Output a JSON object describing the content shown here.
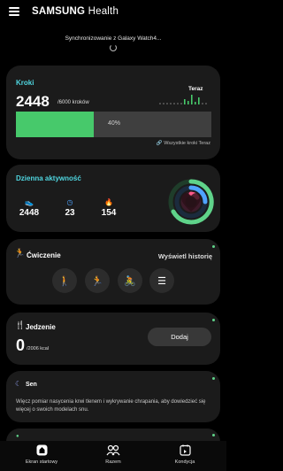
{
  "header": {
    "brand_bold": "SAMSUNG",
    "brand_light": "Health",
    "sync_text": "Synchronizowanie z Galaxy Watch4..."
  },
  "steps": {
    "title": "Kroki",
    "value": "2448",
    "goal": "/6000 kroków",
    "now_label": "Teraz",
    "progress_label": "40%",
    "progress_fraction": 0.4,
    "all_steps_link": "Wszystkie kroki Teraz",
    "accent": "#47c96b"
  },
  "activity": {
    "title": "Dzienna aktywność",
    "items": [
      {
        "icon": "steps-icon",
        "value": "2448",
        "color": "#5fd38a"
      },
      {
        "icon": "active-time-icon",
        "value": "23",
        "color": "#4fa3ff"
      },
      {
        "icon": "calories-icon",
        "value": "154",
        "color": "#ff5a8a"
      }
    ],
    "ring_colors": [
      "#5fd38a",
      "#4fa3ff",
      "#ff5a8a"
    ]
  },
  "exercise": {
    "title": "Ćwiczenie",
    "show_history": "Wyświetl historię",
    "buttons": [
      {
        "icon": "walking-icon",
        "glyph": "🚶"
      },
      {
        "icon": "running-icon",
        "glyph": "🏃"
      },
      {
        "icon": "cycling-icon",
        "glyph": "🚴"
      },
      {
        "icon": "list-icon",
        "glyph": "☰"
      }
    ]
  },
  "food": {
    "title": "Jedzenie",
    "value": "0",
    "unit": "/2006 kcal",
    "add_label": "Dodaj"
  },
  "sleep": {
    "title": "Sen",
    "text": "Więcz pomiar nasycenia krwi tlenem i wykrywanie chrapania, aby dowiedzieć się więcej o swoich modelach snu."
  },
  "nav": {
    "items": [
      {
        "label": "Ekran startowy",
        "icon": "home-icon"
      },
      {
        "label": "Razem",
        "icon": "together-icon"
      },
      {
        "label": "Kondycja",
        "icon": "fitness-icon"
      }
    ]
  },
  "colors": {
    "background": "#000000",
    "card": "#1b1b1b",
    "title_accent": "#4fd6e0",
    "green": "#47c96b"
  }
}
